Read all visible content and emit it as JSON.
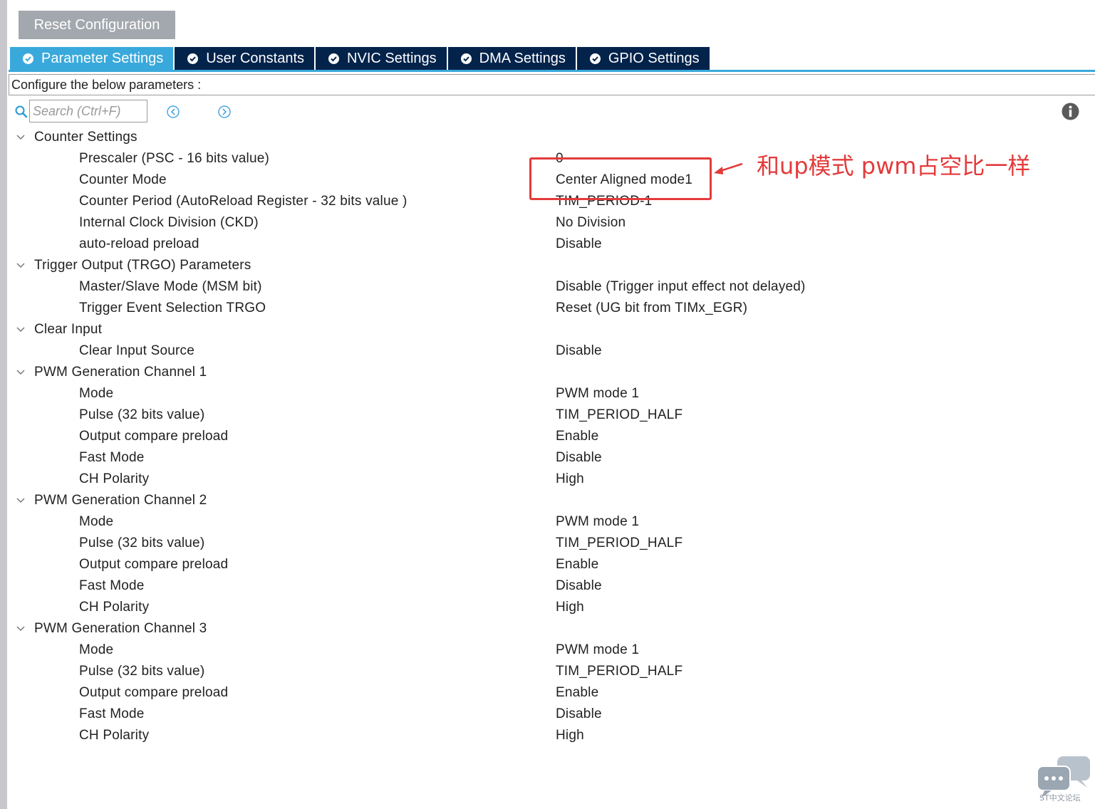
{
  "toolbar": {
    "reset_label": "Reset Configuration"
  },
  "tabs": [
    {
      "label": "Parameter Settings",
      "active": true
    },
    {
      "label": "User Constants",
      "active": false
    },
    {
      "label": "NVIC Settings",
      "active": false
    },
    {
      "label": "DMA Settings",
      "active": false
    },
    {
      "label": "GPIO Settings",
      "active": false
    }
  ],
  "configure_label": "Configure the below parameters :",
  "search": {
    "placeholder": "Search (Ctrl+F)",
    "value": ""
  },
  "groups": [
    {
      "label": "Counter Settings",
      "params": [
        {
          "label": "Prescaler (PSC - 16 bits value)",
          "value": "0"
        },
        {
          "label": "Counter Mode",
          "value": "Center Aligned mode1"
        },
        {
          "label": "Counter Period (AutoReload Register - 32 bits value )",
          "value": "TIM_PERIOD-1"
        },
        {
          "label": "Internal Clock Division (CKD)",
          "value": "No Division"
        },
        {
          "label": "auto-reload preload",
          "value": "Disable"
        }
      ]
    },
    {
      "label": "Trigger Output (TRGO) Parameters",
      "params": [
        {
          "label": "Master/Slave Mode (MSM bit)",
          "value": "Disable (Trigger input effect not delayed)"
        },
        {
          "label": "Trigger Event Selection TRGO",
          "value": "Reset (UG bit from TIMx_EGR)"
        }
      ]
    },
    {
      "label": "Clear Input",
      "params": [
        {
          "label": "Clear Input Source",
          "value": "Disable"
        }
      ]
    },
    {
      "label": "PWM Generation Channel 1",
      "params": [
        {
          "label": "Mode",
          "value": "PWM mode 1"
        },
        {
          "label": "Pulse (32 bits value)",
          "value": "TIM_PERIOD_HALF"
        },
        {
          "label": "Output compare preload",
          "value": "Enable"
        },
        {
          "label": "Fast Mode",
          "value": "Disable"
        },
        {
          "label": "CH Polarity",
          "value": "High"
        }
      ]
    },
    {
      "label": "PWM Generation Channel 2",
      "params": [
        {
          "label": "Mode",
          "value": "PWM mode 1"
        },
        {
          "label": "Pulse (32 bits value)",
          "value": "TIM_PERIOD_HALF"
        },
        {
          "label": "Output compare preload",
          "value": "Enable"
        },
        {
          "label": "Fast Mode",
          "value": "Disable"
        },
        {
          "label": "CH Polarity",
          "value": "High"
        }
      ]
    },
    {
      "label": "PWM Generation Channel 3",
      "params": [
        {
          "label": "Mode",
          "value": "PWM mode 1"
        },
        {
          "label": "Pulse (32 bits value)",
          "value": "TIM_PERIOD_HALF"
        },
        {
          "label": "Output compare preload",
          "value": "Enable"
        },
        {
          "label": "Fast Mode",
          "value": "Disable"
        },
        {
          "label": "CH Polarity",
          "value": "High"
        }
      ]
    }
  ],
  "annotation": {
    "text": "和up模式  pwm占空比一样",
    "color": "#e43a3a"
  },
  "watermark": {
    "text": "ST中文论坛"
  },
  "icons": {
    "search": "search-icon",
    "prev": "chevron-left-circle-icon",
    "next": "chevron-right-circle-icon",
    "info": "info-icon",
    "tab_check": "check-circle-icon",
    "group_toggle": "chevron-down-icon"
  },
  "colors": {
    "tab_active": "#39a9dc",
    "tab_inactive": "#03234b",
    "reset_button": "#a3a8ae"
  }
}
